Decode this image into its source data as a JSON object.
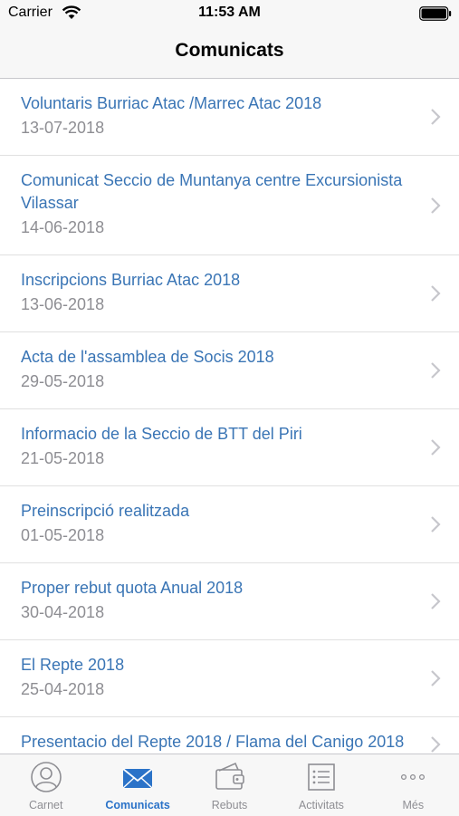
{
  "status_bar": {
    "carrier": "Carrier",
    "time": "11:53 AM"
  },
  "nav": {
    "title": "Comunicats"
  },
  "items": [
    {
      "title": "Voluntaris Burriac Atac /Marrec Atac 2018",
      "date": "13-07-2018"
    },
    {
      "title": "Comunicat Seccio de Muntanya centre Excursionista Vilassar",
      "date": "14-06-2018"
    },
    {
      "title": "Inscripcions Burriac Atac 2018",
      "date": "13-06-2018"
    },
    {
      "title": "Acta de l'assamblea de Socis 2018",
      "date": "29-05-2018"
    },
    {
      "title": "Informacio de la Seccio de BTT del Piri",
      "date": "21-05-2018"
    },
    {
      "title": "Preinscripció realitzada",
      "date": "01-05-2018"
    },
    {
      "title": "Proper rebut quota Anual 2018",
      "date": "30-04-2018"
    },
    {
      "title": "El Repte 2018",
      "date": "25-04-2018"
    },
    {
      "title": "Presentacio del Repte 2018 / Flama del Canigo 2018",
      "date": ""
    }
  ],
  "tabs": [
    {
      "label": "Carnet",
      "icon": "person-icon",
      "active": false
    },
    {
      "label": "Comunicats",
      "icon": "envelope-icon",
      "active": true
    },
    {
      "label": "Rebuts",
      "icon": "wallet-icon",
      "active": false
    },
    {
      "label": "Activitats",
      "icon": "list-icon",
      "active": false
    },
    {
      "label": "Més",
      "icon": "more-icon",
      "active": false
    }
  ],
  "colors": {
    "accent": "#2b73c8",
    "link": "#3a75b5",
    "secondary": "#8e8e93"
  }
}
